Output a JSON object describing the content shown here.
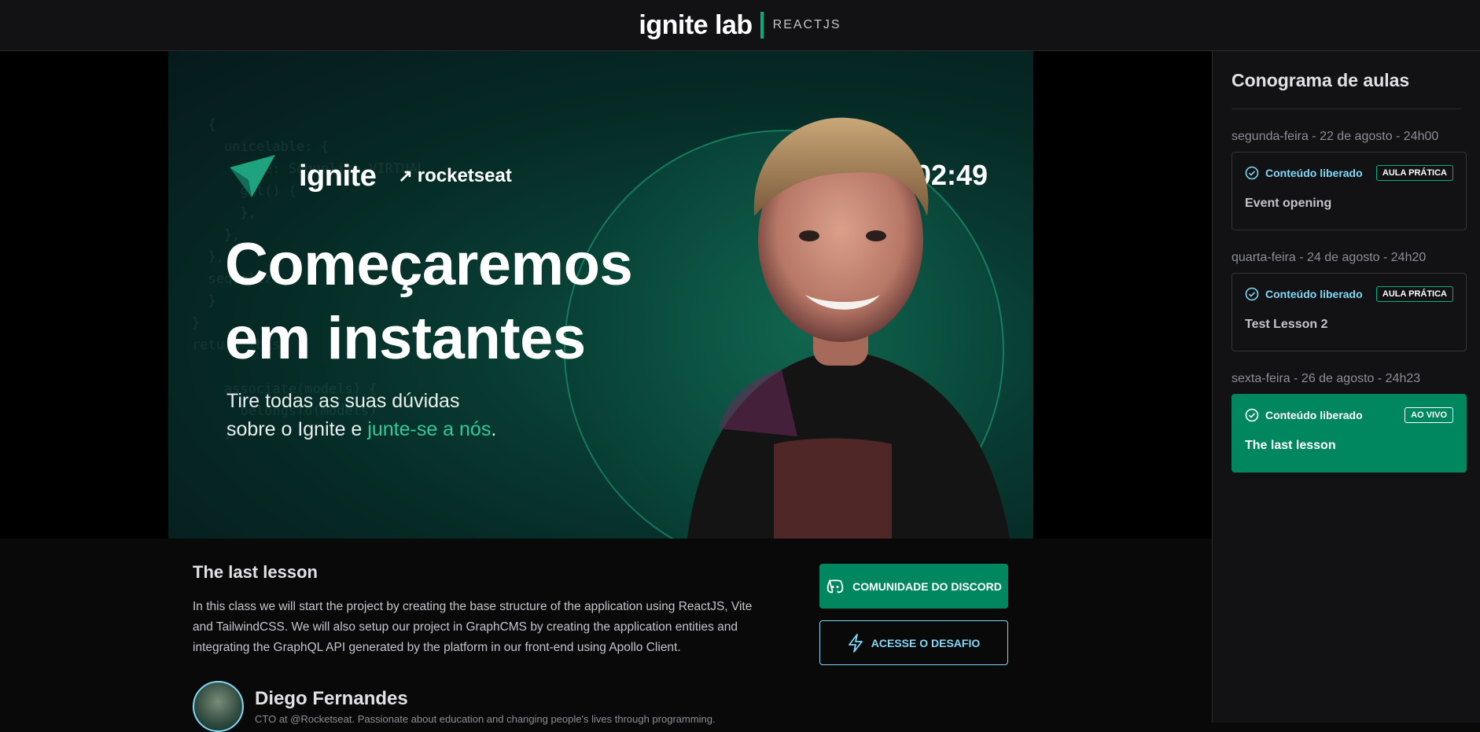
{
  "header": {
    "logo_word": "ignite lab",
    "logo_tag": "REACTJS"
  },
  "video": {
    "brand_ignite": "ignite",
    "brand_rocket": "rocketseat",
    "timer": "02:49",
    "headline_line1": "Começaremos",
    "headline_line2": "em instantes",
    "sub_line1": "Tire todas as suas dúvidas",
    "sub_line2_prefix": "sobre o Ignite e ",
    "sub_line2_highlight": "junte-se a nós",
    "sub_line2_suffix": ".",
    "accent_color": "#2dcaa0"
  },
  "lesson": {
    "title": "The last lesson",
    "description": "In this class we will start the project by creating the base structure of the application using ReactJS, Vite and TailwindCSS. We will also setup our project in GraphCMS by creating the application entities and integrating the GraphQL API generated by the platform in our front-end using Apollo Client."
  },
  "author": {
    "name": "Diego Fernandes",
    "bio": "CTO at @Rocketseat. Passionate about education and changing people's lives through programming."
  },
  "buttons": {
    "discord": "COMUNIDADE DO DISCORD",
    "challenge": "ACESSE O DESAFIO"
  },
  "sidebar": {
    "title": "Conograma de aulas",
    "lessons": [
      {
        "date": "segunda-feira - 22 de agosto - 24h00",
        "status": "Conteúdo liberado",
        "badge": "AULA PRÁTICA",
        "title": "Event opening"
      },
      {
        "date": "quarta-feira - 24 de agosto - 24h20",
        "status": "Conteúdo liberado",
        "badge": "AULA PRÁTICA",
        "title": "Test Lesson 2"
      },
      {
        "date": "sexta-feira - 26 de agosto - 24h23",
        "status": "Conteúdo liberado",
        "badge": "AO VIVO",
        "title": "The last lesson"
      }
    ]
  },
  "colors": {
    "brand": "#00875f",
    "accent": "#81d8f7",
    "background": "#09090a",
    "panel": "#121214"
  }
}
